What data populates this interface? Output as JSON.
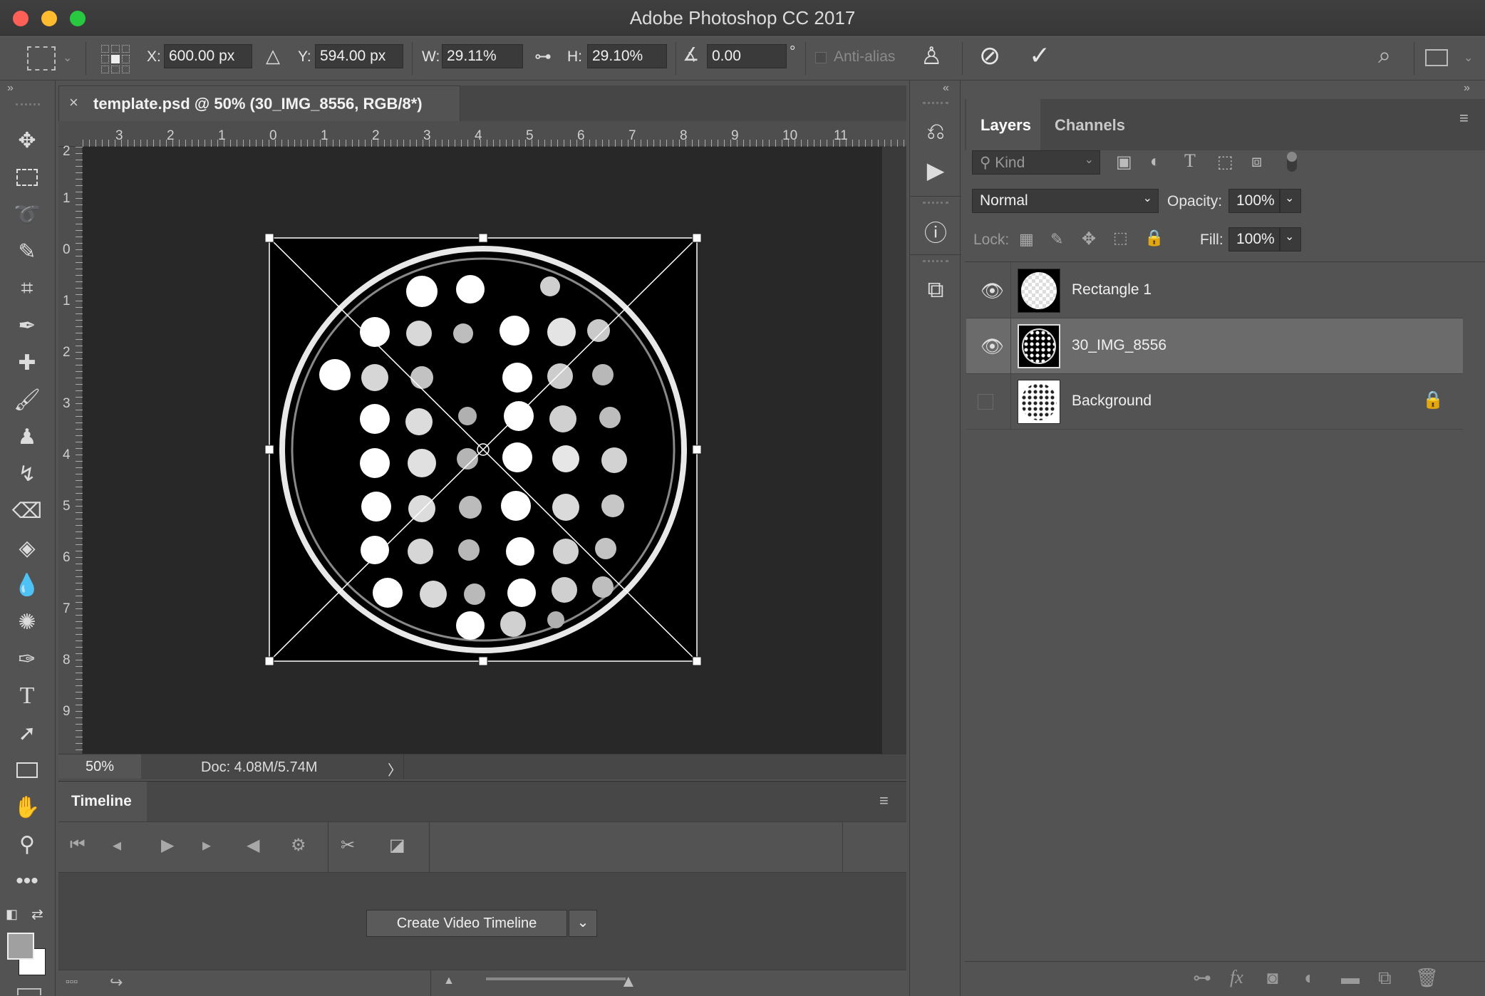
{
  "window": {
    "title": "Adobe Photoshop CC 2017",
    "traffic_lights": [
      "#fe5f57",
      "#febc2e",
      "#28c840"
    ]
  },
  "options_bar": {
    "x_label": "X:",
    "x_value": "600.00 px",
    "y_label": "Y:",
    "y_value": "594.00 px",
    "w_label": "W:",
    "w_value": "29.11%",
    "h_label": "H:",
    "h_value": "29.10%",
    "angle_value": "0.00",
    "degree_symbol": "°",
    "antialias_label": "Anti-alias"
  },
  "tools": [
    "move-tool",
    "marquee-tool",
    "lasso-tool",
    "quick-select-tool",
    "crop-tool",
    "eyedropper-tool",
    "healing-tool",
    "brush-tool",
    "stamp-tool",
    "history-brush-tool",
    "eraser-tool",
    "paint-bucket-tool",
    "blur-tool",
    "sponge-tool",
    "pen-tool",
    "type-tool",
    "path-select-tool",
    "rectangle-tool",
    "hand-tool",
    "zoom-tool",
    "more-tools"
  ],
  "document": {
    "tab_title": "template.psd @ 50% (30_IMG_8556, RGB/8*)",
    "top_ruler": [
      "3",
      "2",
      "1",
      "0",
      "1",
      "2",
      "3",
      "4",
      "5",
      "6",
      "7",
      "8",
      "9",
      "10",
      "11"
    ],
    "left_ruler": [
      "2",
      "1",
      "0",
      "1",
      "2",
      "3",
      "4",
      "5",
      "6",
      "7",
      "8",
      "9"
    ],
    "zoom": "50%",
    "doc_size": "Doc: 4.08M/5.74M",
    "status_arrow": "〉"
  },
  "timeline": {
    "tab": "Timeline",
    "create_button": "Create Video Timeline",
    "dropdown_arrow": "⌄"
  },
  "layers_panel": {
    "tabs": [
      "Layers",
      "Channels"
    ],
    "filter_placeholder": "Kind",
    "blend_mode": "Normal",
    "opacity_label": "Opacity:",
    "opacity_value": "100%",
    "lock_label": "Lock:",
    "fill_label": "Fill:",
    "fill_value": "100%",
    "layers": [
      {
        "name": "Rectangle 1",
        "visible": true,
        "selected": false,
        "locked": false
      },
      {
        "name": "30_IMG_8556",
        "visible": true,
        "selected": true,
        "locked": false
      },
      {
        "name": "Background",
        "visible": false,
        "selected": false,
        "locked": true
      }
    ]
  },
  "colors": {
    "panel_bg": "#535353",
    "canvas_bg": "#282828",
    "selected_layer": "#6b6b6b",
    "accent_text": "#ffffff"
  }
}
